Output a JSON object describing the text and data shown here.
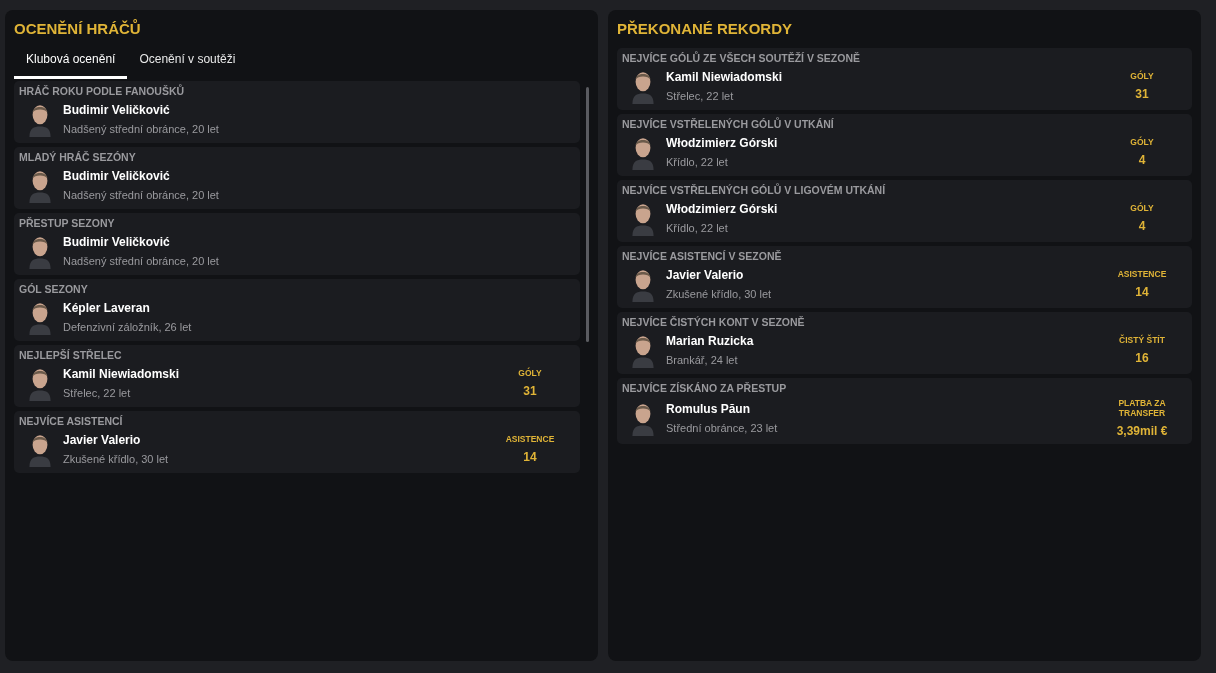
{
  "awards_panel": {
    "title": "OCENĚNÍ HRÁČŮ",
    "tabs": [
      {
        "label": "Klubová ocenění",
        "selected": true
      },
      {
        "label": "Ocenění v soutěži",
        "selected": false
      }
    ],
    "awards": [
      {
        "category": "HRÁČ ROKU PODLE FANOUŠKŮ",
        "player": "Budimir Veličković",
        "description": "Nadšený střední obránce, 20 let"
      },
      {
        "category": "MLADÝ HRÁČ SEZÓNY",
        "player": "Budimir Veličković",
        "description": "Nadšený střední obránce, 20 let"
      },
      {
        "category": "PŘESTUP SEZONY",
        "player": "Budimir Veličković",
        "description": "Nadšený střední obránce, 20 let"
      },
      {
        "category": "GÓL SEZONY",
        "player": "Képler Laveran",
        "description": "Defenzivní záložník, 26 let"
      },
      {
        "category": "NEJLEPŠÍ STŘELEC",
        "player": "Kamil Niewiadomski",
        "description": "Střelec, 22 let",
        "stat_label": "GÓLY",
        "stat_value": "31"
      },
      {
        "category": "NEJVÍCE ASISTENCÍ",
        "player": "Javier Valerio",
        "description": "Zkušené křídlo, 30 let",
        "stat_label": "ASISTENCE",
        "stat_value": "14"
      }
    ]
  },
  "records_panel": {
    "title": "PŘEKONANÉ REKORDY",
    "records": [
      {
        "category": "NEJVÍCE GÓLŮ ZE VŠECH SOUTĚŽÍ V SEZONĚ",
        "player": "Kamil Niewiadomski",
        "description": "Střelec, 22 let",
        "stat_label": "GÓLY",
        "stat_value": "31"
      },
      {
        "category": "NEJVÍCE VSTŘELENÝCH GÓLŮ V UTKÁNÍ",
        "player": "Włodzimierz Górski",
        "description": "Křídlo, 22 let",
        "stat_label": "GÓLY",
        "stat_value": "4"
      },
      {
        "category": "NEJVÍCE VSTŘELENÝCH GÓLŮ V LIGOVÉM UTKÁNÍ",
        "player": "Włodzimierz Górski",
        "description": "Křídlo, 22 let",
        "stat_label": "GÓLY",
        "stat_value": "4"
      },
      {
        "category": "NEJVÍCE ASISTENCÍ V SEZONĚ",
        "player": "Javier Valerio",
        "description": "Zkušené křídlo, 30 let",
        "stat_label": "ASISTENCE",
        "stat_value": "14"
      },
      {
        "category": "NEJVÍCE ČISTÝCH KONT V SEZONĚ",
        "player": "Marian Ruzicka",
        "description": "Brankář, 24 let",
        "stat_label": "ČISTÝ ŠTÍT",
        "stat_value": "16"
      },
      {
        "category": "NEJVÍCE ZÍSKÁNO ZA PŘESTUP",
        "player": "Romulus Păun",
        "description": "Střední obránce, 23 let",
        "stat_label": "PLATBA ZA TRANSFER",
        "stat_value": "3,39mil €"
      }
    ]
  }
}
